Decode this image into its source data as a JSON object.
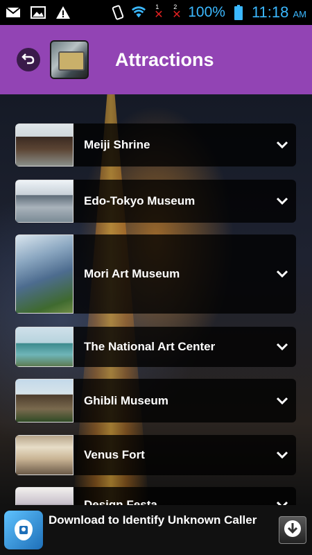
{
  "status_bar": {
    "icons": [
      "gmail-icon",
      "image-icon",
      "warning-icon",
      "vibrate-icon",
      "wifi-icon",
      "sim-1-no-signal-icon",
      "sim-2-no-signal-icon",
      "battery-icon"
    ],
    "sim1_number": "1",
    "sim2_number": "2",
    "battery_percent": "100%",
    "time": "11:18",
    "ampm": "AM"
  },
  "header": {
    "title": "Attractions",
    "background_color": "#9244b4"
  },
  "attractions": [
    {
      "label": "Meiji Shrine"
    },
    {
      "label": "Edo-Tokyo Museum"
    },
    {
      "label": "Mori Art Museum"
    },
    {
      "label": "The National Art Center"
    },
    {
      "label": "Ghibli Museum"
    },
    {
      "label": "Venus Fort"
    },
    {
      "label": "Design Festa"
    }
  ],
  "ad": {
    "text": "Download to Identify Unknown Caller"
  }
}
